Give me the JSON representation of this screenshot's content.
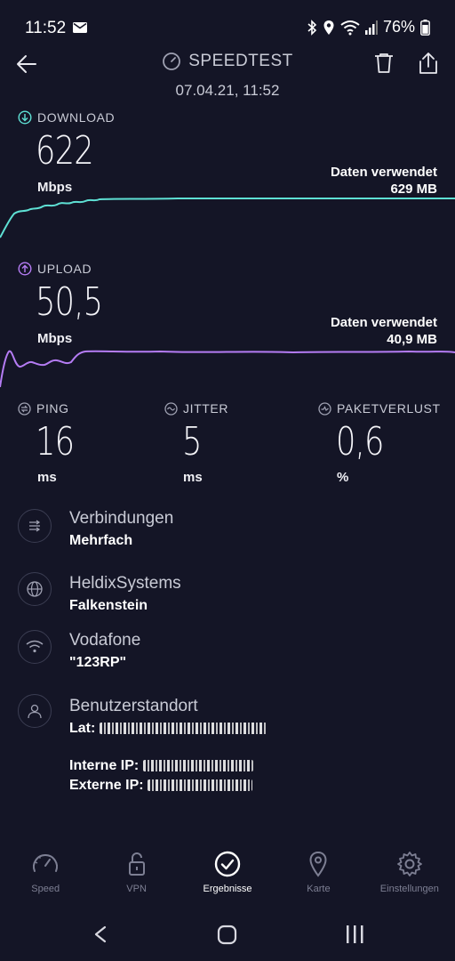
{
  "status_bar": {
    "time": "11:52",
    "battery": "76%"
  },
  "header": {
    "title": "SPEEDTEST",
    "datetime": "07.04.21, 11:52"
  },
  "download": {
    "label": "DOWNLOAD",
    "value": "622",
    "unit": "Mbps",
    "data_used_label": "Daten verwendet",
    "data_used_value": "629 MB",
    "color": "#5ee0d4"
  },
  "upload": {
    "label": "UPLOAD",
    "value": "50,5",
    "unit": "Mbps",
    "data_used_label": "Daten verwendet",
    "data_used_value": "40,9 MB",
    "color": "#b57cf4"
  },
  "metrics": {
    "ping": {
      "label": "PING",
      "value": "16",
      "unit": "ms"
    },
    "jitter": {
      "label": "JITTER",
      "value": "5",
      "unit": "ms"
    },
    "loss": {
      "label": "PAKETVERLUST",
      "value": "0,6",
      "unit": "%"
    }
  },
  "info": {
    "connections": {
      "title": "Verbindungen",
      "value": "Mehrfach"
    },
    "server": {
      "title": "HeldixSystems",
      "value": "Falkenstein"
    },
    "provider": {
      "title": "Vodafone",
      "value": "\"123RP\""
    },
    "location": {
      "title": "Benutzerstandort",
      "lat_label": "Lat:",
      "internal_ip_label": "Interne IP:",
      "external_ip_label": "Externe IP:"
    }
  },
  "nav": {
    "items": [
      {
        "label": "Speed",
        "icon": "gauge-icon"
      },
      {
        "label": "VPN",
        "icon": "lock-icon"
      },
      {
        "label": "Ergebnisse",
        "icon": "check-circle-icon"
      },
      {
        "label": "Karte",
        "icon": "map-pin-icon"
      },
      {
        "label": "Einstellungen",
        "icon": "gear-icon"
      }
    ],
    "active_index": 2
  }
}
